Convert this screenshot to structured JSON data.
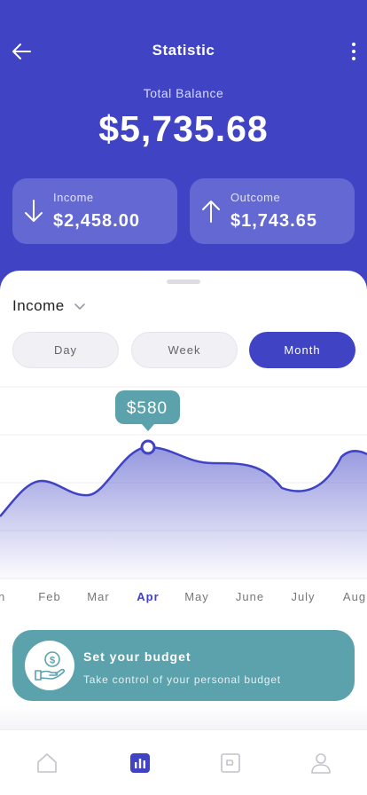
{
  "header": {
    "title": "Statistic",
    "balance_label": "Total Balance",
    "balance_amount": "$5,735.68"
  },
  "cards": [
    {
      "label": "Income",
      "value": "$2,458.00",
      "icon": "arrow-down-icon"
    },
    {
      "label": "Outcome",
      "value": "$1,743.65",
      "icon": "arrow-up-icon"
    }
  ],
  "filter": {
    "selected": "Income"
  },
  "periods": [
    {
      "label": "Day",
      "active": false
    },
    {
      "label": "Week",
      "active": false
    },
    {
      "label": "Month",
      "active": true
    }
  ],
  "chart_data": {
    "type": "area",
    "categories": [
      "Jan",
      "Feb",
      "Mar",
      "Apr",
      "May",
      "June",
      "July",
      "Aug"
    ],
    "visible_categories": [
      "an",
      "Feb",
      "Mar",
      "Apr",
      "May",
      "June",
      "July",
      "Aug"
    ],
    "highlight": {
      "category": "Apr",
      "value": 580,
      "label": "$580"
    },
    "grid": true,
    "line_color": "#3f43c4"
  },
  "budget": {
    "title": "Set your budget",
    "subtitle": "Take control of your personal budget",
    "icon": "money-hand-icon"
  },
  "tabs": [
    {
      "name": "home-icon",
      "active": false
    },
    {
      "name": "stats-icon",
      "active": true
    },
    {
      "name": "wallet-icon",
      "active": false
    },
    {
      "name": "profile-icon",
      "active": false
    }
  ],
  "colors": {
    "primary": "#3f43c4",
    "teal": "#5ba2ad",
    "tooltip": "#5ba2ad"
  }
}
